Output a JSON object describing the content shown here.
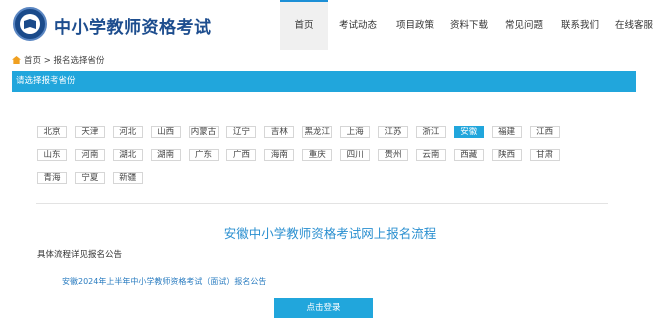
{
  "header": {
    "site_title": "中小学教师资格考试",
    "logo_icon": "emblem-logo-icon"
  },
  "nav": [
    {
      "label": "首页",
      "active": true
    },
    {
      "label": "考试动态"
    },
    {
      "label": "项目政策"
    },
    {
      "label": "资料下载"
    },
    {
      "label": "常见问题"
    },
    {
      "label": "联系我们"
    },
    {
      "label": "在线客服"
    }
  ],
  "breadcrumb": {
    "icon": "home-icon",
    "home": "首页",
    "separator": ">",
    "current": "报名选择省份"
  },
  "province_panel": {
    "title": "请选择报考省份",
    "selected": "安徽",
    "rows": [
      [
        "北京",
        "天津",
        "河北",
        "山西",
        "内蒙古",
        "辽宁",
        "吉林",
        "黑龙江",
        "上海",
        "江苏",
        "浙江",
        "安徽",
        "福建",
        "江西"
      ],
      [
        "山东",
        "河南",
        "湖北",
        "湖南",
        "广东",
        "广西",
        "海南",
        "重庆",
        "四川",
        "贵州",
        "云南",
        "西藏",
        "陕西",
        "甘肃"
      ],
      [
        "青海",
        "宁夏",
        "新疆"
      ]
    ]
  },
  "process": {
    "title": "安徽中小学教师资格考试网上报名流程",
    "note": "具体流程详见报名公告",
    "announcement": "安徽2024年上半年中小学教师资格考试（面试）报名公告",
    "login_button": "点击登录"
  },
  "colors": {
    "accent": "#21a6dc",
    "title_blue": "#1d4d8e",
    "link_blue": "#2a7cc0"
  }
}
